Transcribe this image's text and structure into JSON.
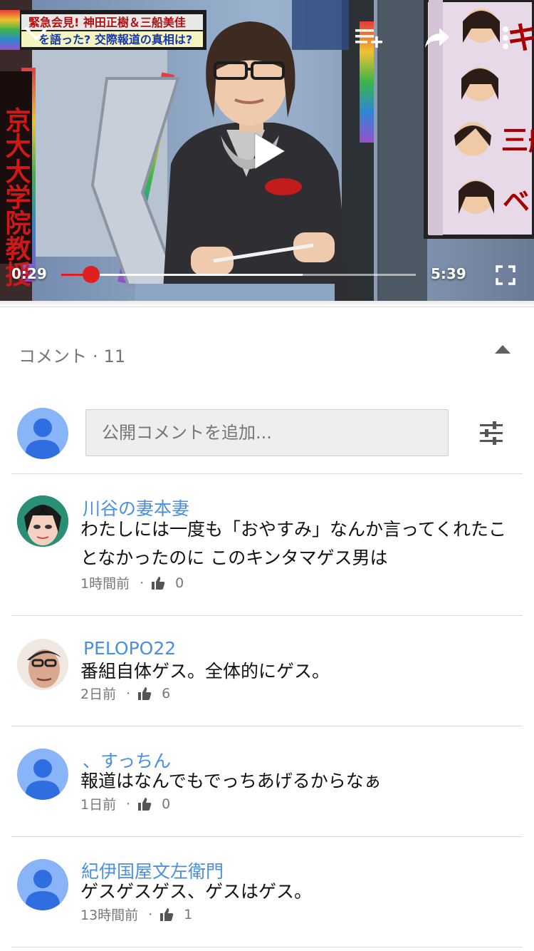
{
  "video": {
    "elapsed": "0:29",
    "duration": "5:39",
    "progress_fraction": 0.085,
    "tv_banner": [
      "緊急会見! 神田正樹＆三船美佳",
      "を語った? 交際報道の真相は?"
    ],
    "tv_side_text": "京大大学院教授",
    "tv_board_text": [
      "キ",
      "三船",
      "ベ"
    ],
    "icons": {
      "collapse": "chevron-down-icon",
      "playlist": "playlist-add-icon",
      "share": "share-icon",
      "more": "more-vert-icon",
      "play": "play-icon",
      "fullscreen": "fullscreen-icon"
    }
  },
  "comments_section": {
    "title": "コメント",
    "separator": "·",
    "count": "11",
    "input_placeholder": "公開コメントを追加...",
    "icons": {
      "collapse": "triangle-up-icon",
      "sort": "sliders-icon",
      "like": "thumb-up-icon"
    },
    "comments": [
      {
        "author": "川谷の妻本妻",
        "lines": [
          "わたしには一度も「おやすみ」なんか言ってくれたこ",
          "となかったのに このキンタマゲス男は"
        ],
        "time": "1時間前",
        "likes": "0",
        "avatar": "custom-drawing"
      },
      {
        "author": "PELOPO22",
        "lines": [
          "番組自体ゲス。全体的にゲス。"
        ],
        "time": "2日前",
        "likes": "6",
        "avatar": "photo"
      },
      {
        "author": "、すっちん",
        "lines": [
          "報道はなんでもでっちあげるからなぁ"
        ],
        "time": "1日前",
        "likes": "0",
        "avatar": "default"
      },
      {
        "author": "紀伊国屋文左衛門",
        "lines": [
          "ゲスゲスゲス、ゲスはゲス。"
        ],
        "time": "13時間前",
        "likes": "1",
        "avatar": "default"
      }
    ]
  },
  "colors": {
    "accent_red": "#e02020",
    "author_blue": "#4a8fe0",
    "avatar_blue": "#8ab4f8"
  }
}
